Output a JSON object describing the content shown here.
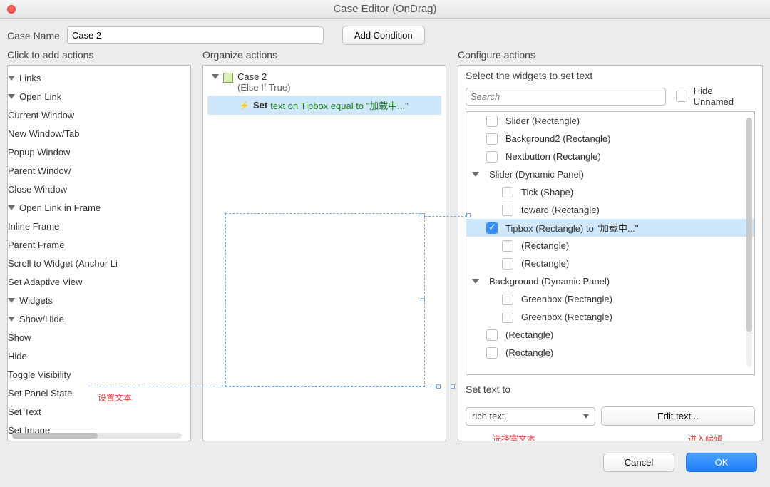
{
  "window": {
    "title": "Case Editor (OnDrag)"
  },
  "caseName": {
    "label": "Case Name",
    "value": "Case 2"
  },
  "buttons": {
    "addCondition": "Add Condition",
    "editText": "Edit text...",
    "cancel": "Cancel",
    "ok": "OK"
  },
  "columns": {
    "left": "Click to add actions",
    "mid": "Organize actions",
    "right": "Configure actions"
  },
  "actionsTree": {
    "links": "Links",
    "openLink": "Open Link",
    "currentWindow": "Current Window",
    "newWindow": "New Window/Tab",
    "popup": "Popup Window",
    "parentWindow": "Parent Window",
    "closeWindow": "Close Window",
    "openLinkFrame": "Open Link in Frame",
    "inlineFrame": "Inline Frame",
    "parentFrame": "Parent Frame",
    "scroll": "Scroll to Widget (Anchor Li",
    "adaptive": "Set Adaptive View",
    "widgets": "Widgets",
    "showHide": "Show/Hide",
    "show": "Show",
    "hide": "Hide",
    "toggle": "Toggle Visibility",
    "panelState": "Set Panel State",
    "setText": "Set Text",
    "setImage": "Set Image"
  },
  "redTips": {
    "setText": "设置文本",
    "selectRich": "选择富文本",
    "enterEdit": "进入编辑"
  },
  "organize": {
    "caseName": "Case 2",
    "caseCond": "(Else If True)",
    "actionVerb": "Set",
    "actionRest": "text on Tipbox equal to \"加载中...\""
  },
  "configure": {
    "header": "Select the widgets to set text",
    "searchPlaceholder": "Search",
    "hideUnnamed": "Hide Unnamed",
    "setTextTo": "Set text to",
    "richText": "rich text"
  },
  "widgetList": [
    {
      "label": "Slider (Rectangle)",
      "indent": "a",
      "checked": false,
      "tog": false
    },
    {
      "label": "Background2 (Rectangle)",
      "indent": "a",
      "checked": false,
      "tog": false
    },
    {
      "label": "Nextbutton (Rectangle)",
      "indent": "a",
      "checked": false,
      "tog": false
    },
    {
      "label": "Slider (Dynamic Panel)",
      "indent": "a",
      "checked": null,
      "tog": true
    },
    {
      "label": "Tick (Shape)",
      "indent": "b",
      "checked": false,
      "tog": false
    },
    {
      "label": "toward (Rectangle)",
      "indent": "b",
      "checked": false,
      "tog": false
    },
    {
      "label": "Tipbox (Rectangle) to \"加载中...\"",
      "indent": "a",
      "checked": true,
      "tog": false,
      "selected": true
    },
    {
      "label": "(Rectangle)",
      "indent": "b",
      "checked": false,
      "tog": false
    },
    {
      "label": "(Rectangle)",
      "indent": "b",
      "checked": false,
      "tog": false
    },
    {
      "label": "Background (Dynamic Panel)",
      "indent": "a",
      "checked": null,
      "tog": true
    },
    {
      "label": "Greenbox (Rectangle)",
      "indent": "b",
      "checked": false,
      "tog": false
    },
    {
      "label": "Greenbox (Rectangle)",
      "indent": "b",
      "checked": false,
      "tog": false
    },
    {
      "label": "(Rectangle)",
      "indent": "a",
      "checked": false,
      "tog": false
    },
    {
      "label": "(Rectangle)",
      "indent": "a",
      "checked": false,
      "tog": false
    }
  ]
}
